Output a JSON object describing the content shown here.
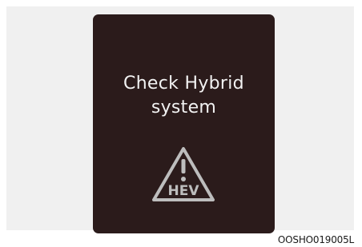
{
  "display": {
    "message_line1": "Check Hybrid",
    "message_line2": "system",
    "icon": "hev-warning-icon",
    "icon_label": "HEV",
    "background_color": "#2b1b1b",
    "text_color": "#f2f2f2"
  },
  "caption": "OOSHO019005L"
}
